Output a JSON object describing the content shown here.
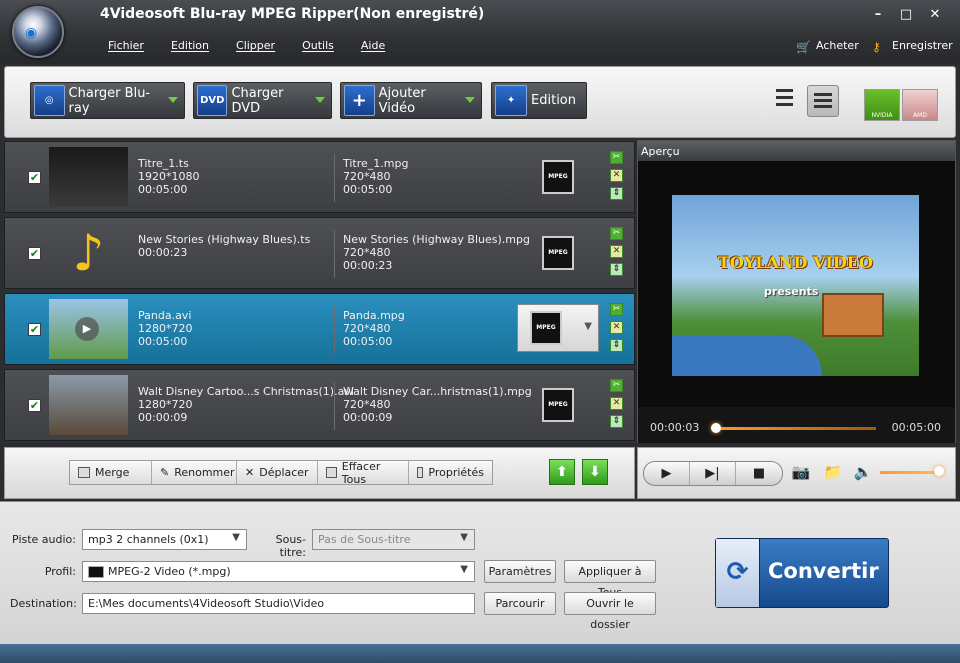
{
  "window": {
    "title": "4Videosoft Blu-ray MPEG Ripper(Non enregistré)",
    "minimize": "–",
    "maximize": "□",
    "close": "✕"
  },
  "menu": [
    "Fichier",
    "Edition",
    "Clipper",
    "Outils",
    "Aide"
  ],
  "topright": {
    "buy": "Acheter",
    "register": "Enregistrer"
  },
  "toolbar": {
    "load_bluray": "Charger Blu-ray",
    "load_dvd": "Charger DVD",
    "add_video": "Ajouter Vidéo",
    "edit": "Edition",
    "dvd_icon_text": "DVD",
    "nvidia": "NVIDIA",
    "amd": "AMD"
  },
  "files": [
    {
      "source_name": "Titre_1.ts",
      "source_res": "1920*1080",
      "source_dur": "00:05:00",
      "out_name": "Titre_1.mpg",
      "out_res": "720*480",
      "out_dur": "00:05:00",
      "checked": true,
      "selected": false
    },
    {
      "source_name": "New Stories (Highway Blues).ts",
      "source_res": "",
      "source_dur": "00:00:23",
      "out_name": "New Stories (Highway Blues).mpg",
      "out_res": "720*480",
      "out_dur": "00:00:23",
      "checked": true,
      "selected": false
    },
    {
      "source_name": "Panda.avi",
      "source_res": "1280*720",
      "source_dur": "00:05:00",
      "out_name": "Panda.mpg",
      "out_res": "720*480",
      "out_dur": "00:05:00",
      "checked": true,
      "selected": true
    },
    {
      "source_name": "Walt Disney Cartoo...s Christmas(1).avi",
      "source_res": "1280*720",
      "source_dur": "00:00:09",
      "out_name": "Walt Disney Car...hristmas(1).mpg",
      "out_res": "720*480",
      "out_dur": "00:00:09",
      "checked": true,
      "selected": false
    }
  ],
  "format_badge": "MPEG",
  "listbar": {
    "merge": "Merge",
    "rename": "Renommer",
    "move": "Déplacer",
    "clear_all": "Effacer Tous",
    "properties": "Propriétés"
  },
  "preview": {
    "title": "Aperçu",
    "video_title": "TOYLAND VIDEO",
    "video_subtitle": "presents",
    "current_time": "00:00:03",
    "duration": "00:05:00",
    "progress": 0.01,
    "volume": 1.0
  },
  "settings": {
    "audio_label": "Piste audio:",
    "audio_value": "mp3 2 channels (0x1)",
    "subtitle_label": "Sous-titre:",
    "subtitle_value": "Pas de Sous-titre",
    "profile_label": "Profil:",
    "profile_value": "MPEG-2 Video (*.mpg)",
    "destination_label": "Destination:",
    "destination_value": "E:\\Mes documents\\4Videosoft Studio\\Video",
    "params_button": "Paramètres",
    "apply_all_button": "Appliquer à Tous",
    "browse_button": "Parcourir",
    "open_folder_button": "Ouvrir le dossier",
    "convert_button": "Convertir"
  },
  "colors": {
    "accent": "#1f7fa8",
    "convert": "#2a65ad",
    "progress": "#ff9a2a"
  }
}
